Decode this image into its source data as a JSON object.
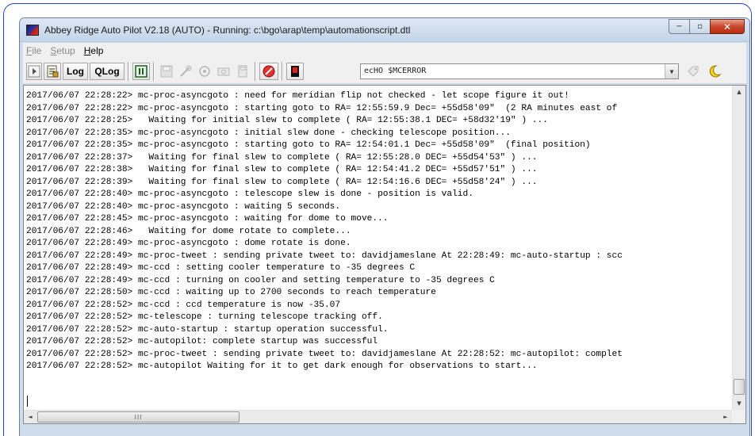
{
  "window": {
    "title": "Abbey Ridge Auto Pilot V2.18 (AUTO) - Running: c:\\bgo\\arap\\temp\\automationscript.dtl",
    "caption": {
      "minimize": "−",
      "maximize": "▫",
      "close": "✕"
    }
  },
  "menu": [
    {
      "label": "File",
      "mnemonic": "F",
      "rest": "ile",
      "enabled": false
    },
    {
      "label": "Setup",
      "mnemonic": "S",
      "rest": "etup",
      "enabled": false
    },
    {
      "label": "Help",
      "mnemonic": "H",
      "rest": "elp",
      "enabled": true
    }
  ],
  "toolbar": {
    "log_label": "Log",
    "qlog_label": "QLog",
    "command_value": "ecHO $MCERROR"
  },
  "log": {
    "lines": [
      "2017/06/07 22:28:22> mc-proc-asyncgoto : need for meridian flip not checked - let scope figure it out!",
      "2017/06/07 22:28:22> mc-proc-asyncgoto : starting goto to RA= 12:55:59.9 Dec= +55d58'09\"  (2 RA minutes east of",
      "2017/06/07 22:28:25>   Waiting for initial slew to complete ( RA= 12:55:38.1 DEC= +58d32'19\" ) ...",
      "2017/06/07 22:28:35> mc-proc-asyncgoto : initial slew done - checking telescope position...",
      "2017/06/07 22:28:35> mc-proc-asyncgoto : starting goto to RA= 12:54:01.1 Dec= +55d58'09\"  (final position)",
      "2017/06/07 22:28:37>   Waiting for final slew to complete ( RA= 12:55:28.0 DEC= +55d54'53\" ) ...",
      "2017/06/07 22:28:38>   Waiting for final slew to complete ( RA= 12:54:41.2 DEC= +55d57'51\" ) ...",
      "2017/06/07 22:28:39>   Waiting for final slew to complete ( RA= 12:54:16.6 DEC= +55d58'24\" ) ...",
      "2017/06/07 22:28:40> mc-proc-asyncgoto : telescope slew is done - position is valid.",
      "2017/06/07 22:28:40> mc-proc-asyncgoto : waiting 5 seconds.",
      "2017/06/07 22:28:45> mc-proc-asyncgoto : waiting for dome to move...",
      "2017/06/07 22:28:46>   Waiting for dome rotate to complete...",
      "2017/06/07 22:28:49> mc-proc-asyncgoto : dome rotate is done.",
      "2017/06/07 22:28:49> mc-proc-tweet : sending private tweet to: davidjameslane At 22:28:49: mc-auto-startup : scc",
      "2017/06/07 22:28:49> mc-ccd : setting cooler temperature to -35 degrees C",
      "2017/06/07 22:28:49> mc-ccd : turning on cooler and setting temperature to -35 degrees C",
      "2017/06/07 22:28:50> mc-ccd : waiting up to 2700 seconds to reach temperature",
      "2017/06/07 22:28:52> mc-ccd : ccd temperature is now -35.07",
      "2017/06/07 22:28:52> mc-telescope : turning telescope tracking off.",
      "2017/06/07 22:28:52> mc-auto-startup : startup operation successful.",
      "2017/06/07 22:28:52> mc-autopilot: complete startup was successful",
      "2017/06/07 22:28:52> mc-proc-tweet : sending private tweet to: davidjameslane At 22:28:52: mc-autopilot: complet",
      "2017/06/07 22:28:52> mc-autopilot Waiting for it to get dark enough for observations to start..."
    ]
  },
  "scrollbars": {
    "vertical_up": "▲",
    "vertical_down": "▼",
    "horizontal_left": "◄",
    "horizontal_right": "►",
    "thumb_grip": "III"
  }
}
